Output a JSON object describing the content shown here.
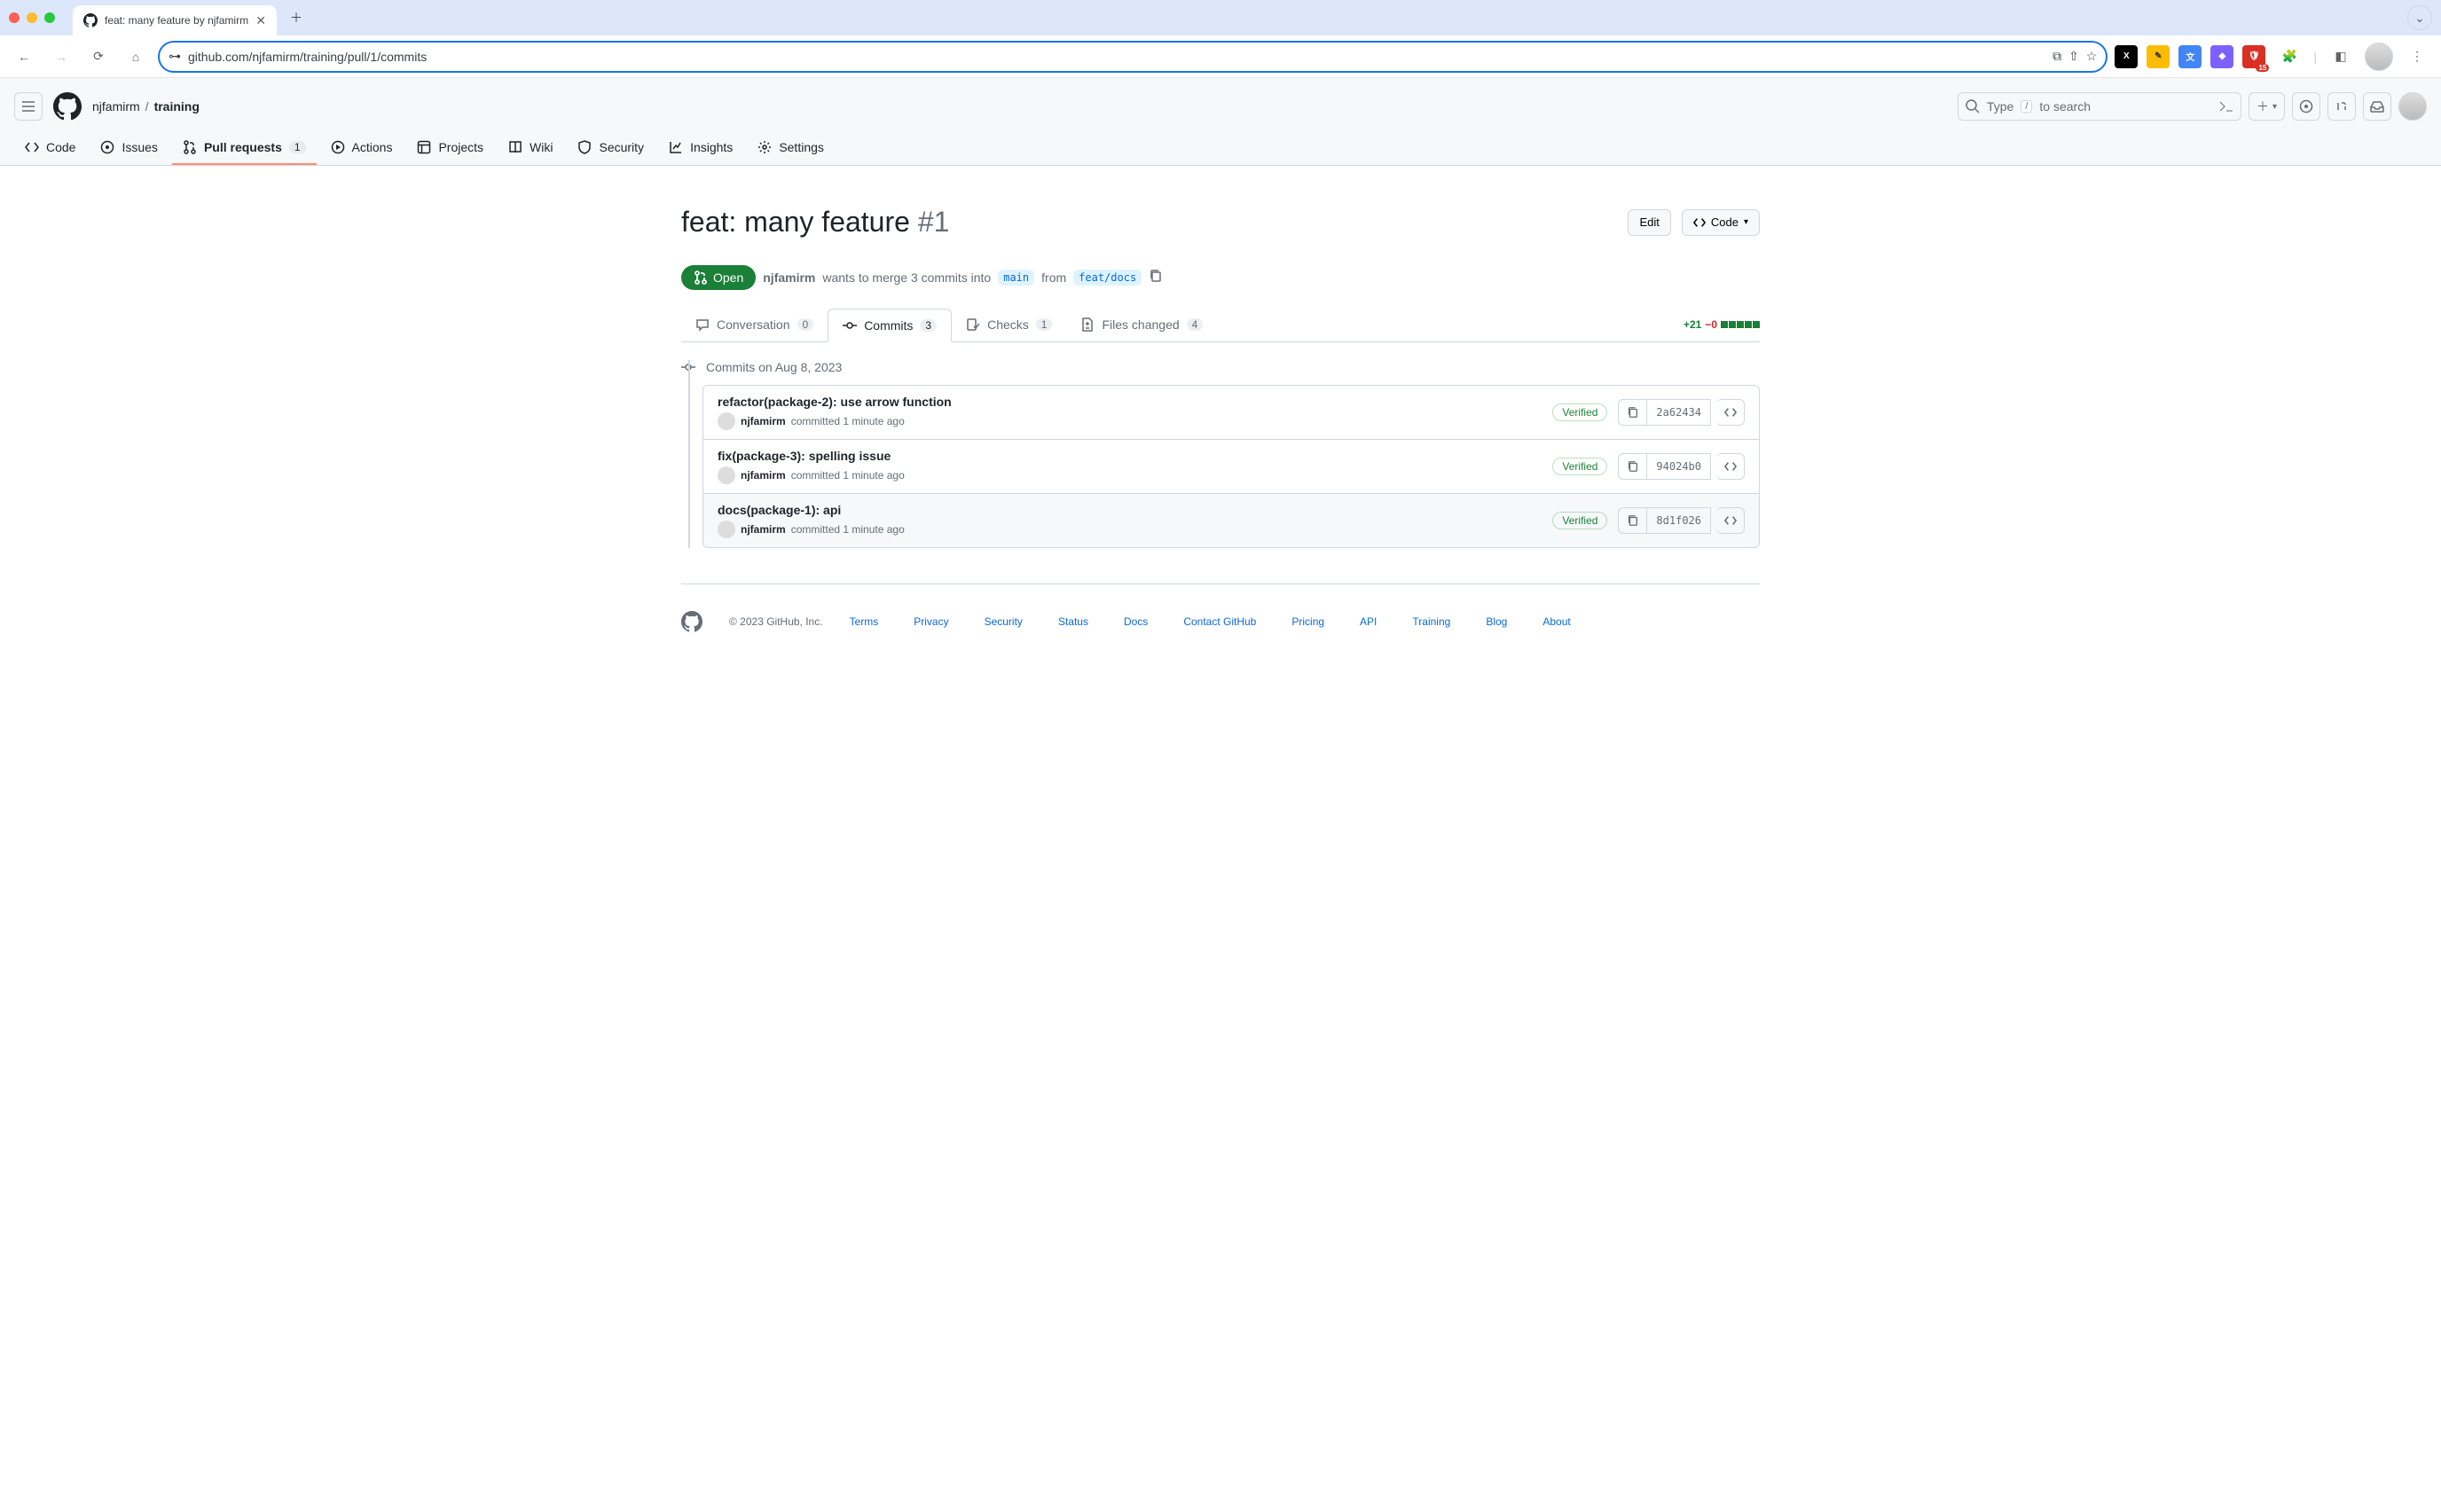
{
  "browser": {
    "tab_title": "feat: many feature by njfamirm",
    "url": "github.com/njfamirm/training/pull/1/commits",
    "ext_badge": "15"
  },
  "header": {
    "owner": "njfamirm",
    "repo": "training",
    "search_pre": "Type",
    "search_key": "/",
    "search_post": "to search"
  },
  "repo_nav": {
    "code": "Code",
    "issues": "Issues",
    "pulls": "Pull requests",
    "pulls_n": "1",
    "actions": "Actions",
    "projects": "Projects",
    "wiki": "Wiki",
    "security": "Security",
    "insights": "Insights",
    "settings": "Settings"
  },
  "pr": {
    "title": "feat: many feature",
    "number": "#1",
    "edit": "Edit",
    "code_btn": "Code",
    "state": "Open",
    "author": "njfamirm",
    "meta": "wants to merge 3 commits into",
    "base": "main",
    "from": "from",
    "head": "feat/docs"
  },
  "tabs": {
    "conversation": "Conversation",
    "conv_n": "0",
    "commits": "Commits",
    "commits_n": "3",
    "checks": "Checks",
    "checks_n": "1",
    "files": "Files changed",
    "files_n": "4",
    "add": "+21",
    "del": "−0"
  },
  "timeline_label": "Commits on Aug 8, 2023",
  "commits": [
    {
      "title": "refactor(package-2): use arrow function",
      "author": "njfamirm",
      "time": "committed 1 minute ago",
      "verified": "Verified",
      "sha": "2a62434"
    },
    {
      "title": "fix(package-3): spelling issue",
      "author": "njfamirm",
      "time": "committed 1 minute ago",
      "verified": "Verified",
      "sha": "94024b0"
    },
    {
      "title": "docs(package-1): api",
      "author": "njfamirm",
      "time": "committed 1 minute ago",
      "verified": "Verified",
      "sha": "8d1f026"
    }
  ],
  "footer": {
    "copyright": "© 2023 GitHub, Inc.",
    "links": [
      "Terms",
      "Privacy",
      "Security",
      "Status",
      "Docs",
      "Contact GitHub",
      "Pricing",
      "API",
      "Training",
      "Blog",
      "About"
    ]
  }
}
